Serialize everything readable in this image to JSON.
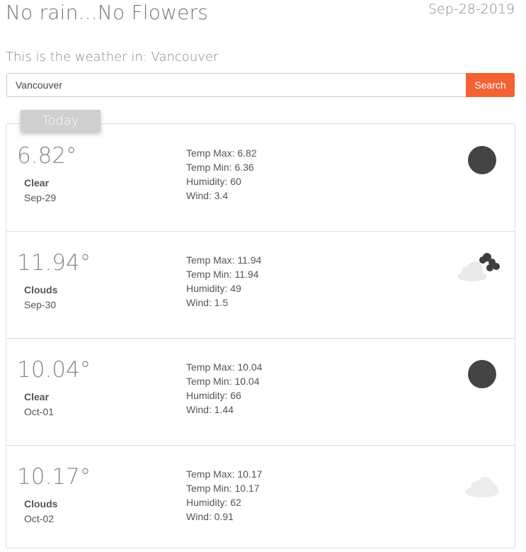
{
  "header": {
    "title": "No rain...No Flowers",
    "date": "Sep-28-2019",
    "subtitle": "This is the weather in: Vancouver"
  },
  "search": {
    "value": "Vancouver",
    "button_label": "Search"
  },
  "today_tab": "Today",
  "forecast": [
    {
      "temp": "6.82°",
      "condition": "Clear",
      "date": "Sep-29",
      "temp_max": "Temp Max: 6.82",
      "temp_min": "Temp Min: 6.36",
      "humidity": "Humidity: 60",
      "wind": "Wind: 3.4",
      "icon": "clear-moon-icon"
    },
    {
      "temp": "11.94°",
      "condition": "Clouds",
      "date": "Sep-30",
      "temp_max": "Temp Max: 11.94",
      "temp_min": "Temp Min: 11.94",
      "humidity": "Humidity: 49",
      "wind": "Wind: 1.5",
      "icon": "broken-clouds-icon"
    },
    {
      "temp": "10.04°",
      "condition": "Clear",
      "date": "Oct-01",
      "temp_max": "Temp Max: 10.04",
      "temp_min": "Temp Min: 10.04",
      "humidity": "Humidity: 66",
      "wind": "Wind: 1.44",
      "icon": "clear-moon-icon"
    },
    {
      "temp": "10.17°",
      "condition": "Clouds",
      "date": "Oct-02",
      "temp_max": "Temp Max: 10.17",
      "temp_min": "Temp Min: 10.17",
      "humidity": "Humidity: 62",
      "wind": "Wind: 0.91",
      "icon": "cloud-icon"
    }
  ],
  "colors": {
    "accent": "#f26232",
    "tab": "#cfcfcf",
    "moon": "#444444",
    "cloud_light": "#e9e9e9",
    "cloud_dark": "#3d3d3d"
  }
}
